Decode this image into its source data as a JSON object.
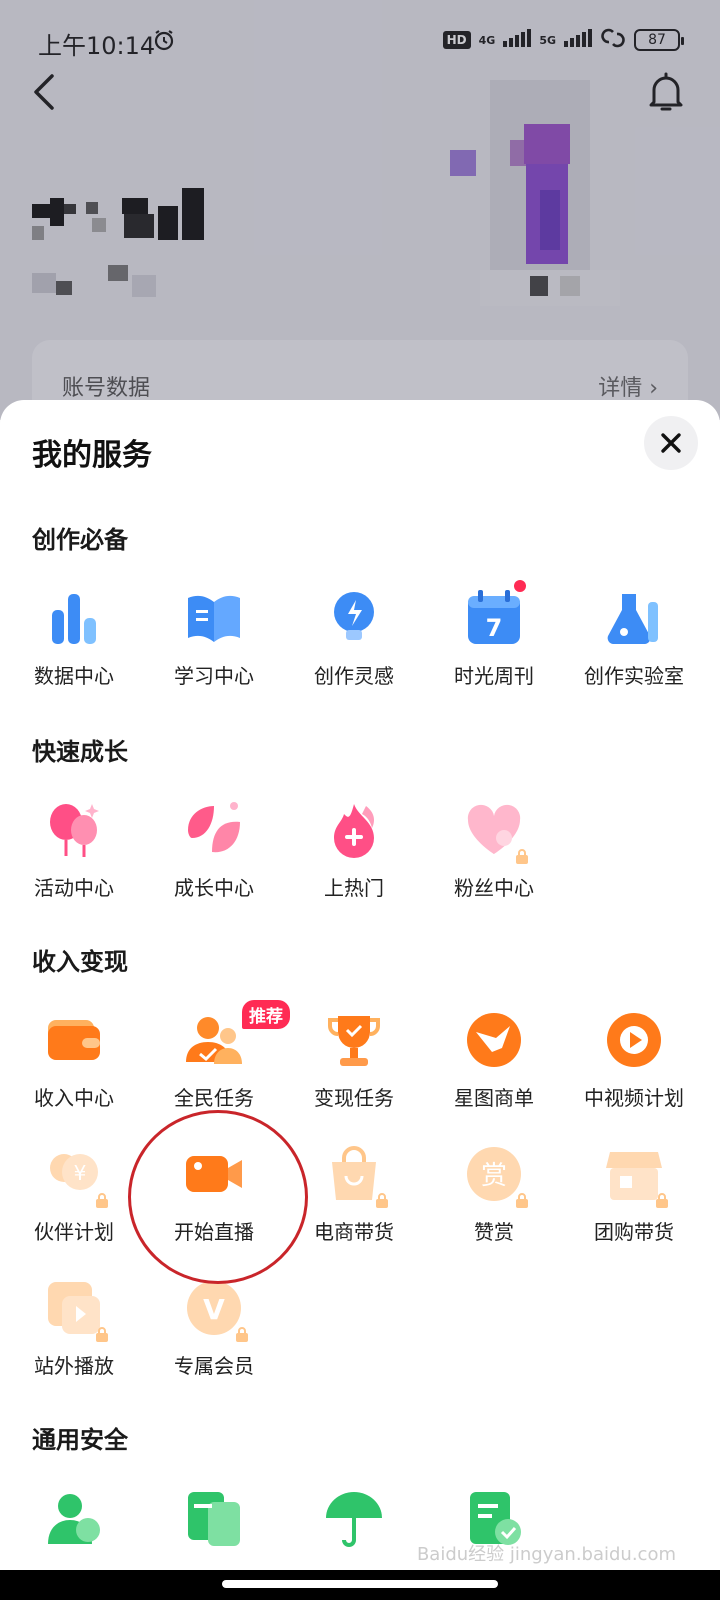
{
  "status": {
    "time": "上午10:14",
    "hd": "HD",
    "net1": "4G",
    "net2": "5G",
    "battery": "87"
  },
  "account": {
    "title": "账号数据",
    "detail": "详情"
  },
  "sheet": {
    "title": "我的服务"
  },
  "sections": [
    {
      "title": "创作必备",
      "items": [
        {
          "label": "数据中心",
          "icon": "bar-chart-icon"
        },
        {
          "label": "学习中心",
          "icon": "book-icon"
        },
        {
          "label": "创作灵感",
          "icon": "lightbulb-icon"
        },
        {
          "label": "时光周刊",
          "icon": "calendar-icon",
          "calendar_day": "7"
        },
        {
          "label": "创作实验室",
          "icon": "flask-icon"
        }
      ]
    },
    {
      "title": "快速成长",
      "items": [
        {
          "label": "活动中心",
          "icon": "balloon-icon"
        },
        {
          "label": "成长中心",
          "icon": "leaf-icon"
        },
        {
          "label": "上热门",
          "icon": "flame-icon"
        },
        {
          "label": "粉丝中心",
          "icon": "heart-icon"
        }
      ]
    },
    {
      "title": "收入变现",
      "items": [
        {
          "label": "收入中心",
          "icon": "wallet-icon"
        },
        {
          "label": "全民任务",
          "icon": "people-icon",
          "badge": "推荐"
        },
        {
          "label": "变现任务",
          "icon": "trophy-icon"
        },
        {
          "label": "星图商单",
          "icon": "star-map-icon"
        },
        {
          "label": "中视频计划",
          "icon": "play-icon"
        },
        {
          "label": "伙伴计划",
          "icon": "partner-icon"
        },
        {
          "label": "开始直播",
          "icon": "camera-icon"
        },
        {
          "label": "电商带货",
          "icon": "shopping-bag-icon"
        },
        {
          "label": "赞赏",
          "icon": "reward-icon",
          "glyph": "赏"
        },
        {
          "label": "团购带货",
          "icon": "store-icon"
        },
        {
          "label": "站外播放",
          "icon": "external-play-icon"
        },
        {
          "label": "专属会员",
          "icon": "vip-icon",
          "glyph": "V"
        }
      ]
    },
    {
      "title": "通用安全",
      "items": []
    }
  ],
  "watermark": "Baidu经验 jingyan.baidu.com",
  "colors": {
    "accent_red": "#ff2b54",
    "annot_red": "#c9252a",
    "orange": "#ff7a1a",
    "blue": "#3d8cf5",
    "pink": "#ff5b8a"
  }
}
